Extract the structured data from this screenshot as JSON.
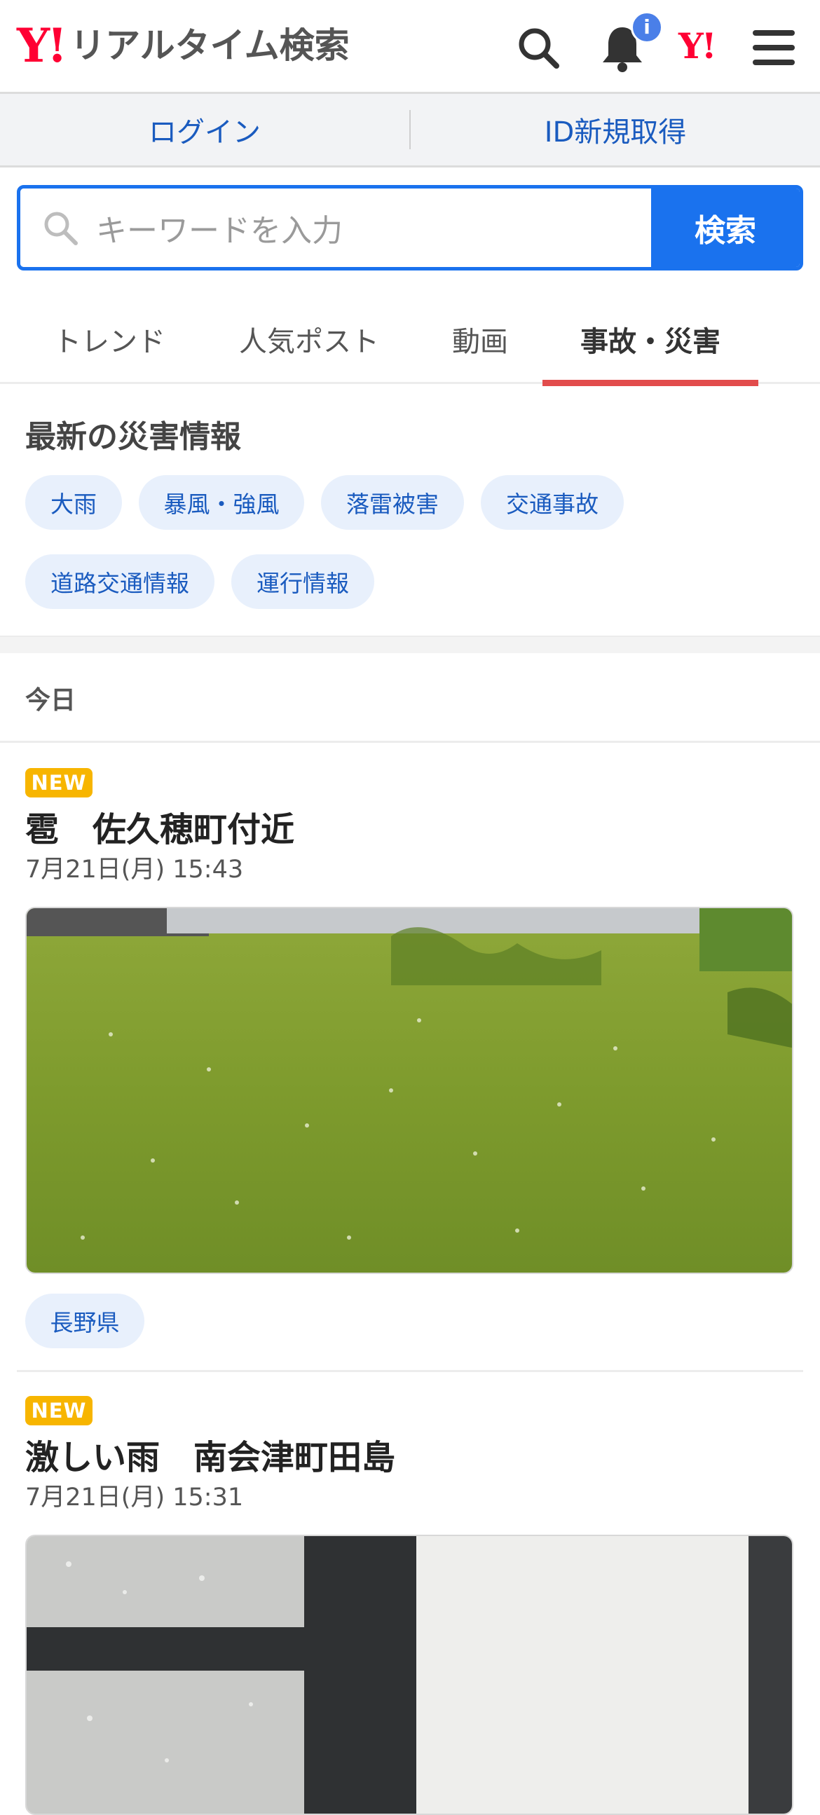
{
  "header": {
    "logo_mark": "Y!",
    "logo_text": "リアルタイム検索",
    "badge": "i",
    "yahoo_mark": "Y!"
  },
  "account": {
    "login": "ログイン",
    "register": "ID新規取得"
  },
  "search": {
    "placeholder": "キーワードを入力",
    "button": "検索"
  },
  "tabs": [
    "トレンド",
    "人気ポスト",
    "動画",
    "事故・災害"
  ],
  "disaster": {
    "title": "最新の災害情報",
    "chips": [
      "大雨",
      "暴風・強風",
      "落雷被害",
      "交通事故",
      "道路交通情報",
      "運行情報"
    ]
  },
  "today_label": "今日",
  "posts": [
    {
      "badge": "NEW",
      "title": "雹　佐久穂町付近",
      "date": "7月21日(月) 15:43",
      "tag": "長野県"
    },
    {
      "badge": "NEW",
      "title": "激しい雨　南会津町田島",
      "date": "7月21日(月) 15:31"
    }
  ],
  "colors": {
    "accent": "#1a72ee",
    "brand": "#ff0033",
    "active_tab": "#e24c4c",
    "new_badge": "#f7b500"
  }
}
